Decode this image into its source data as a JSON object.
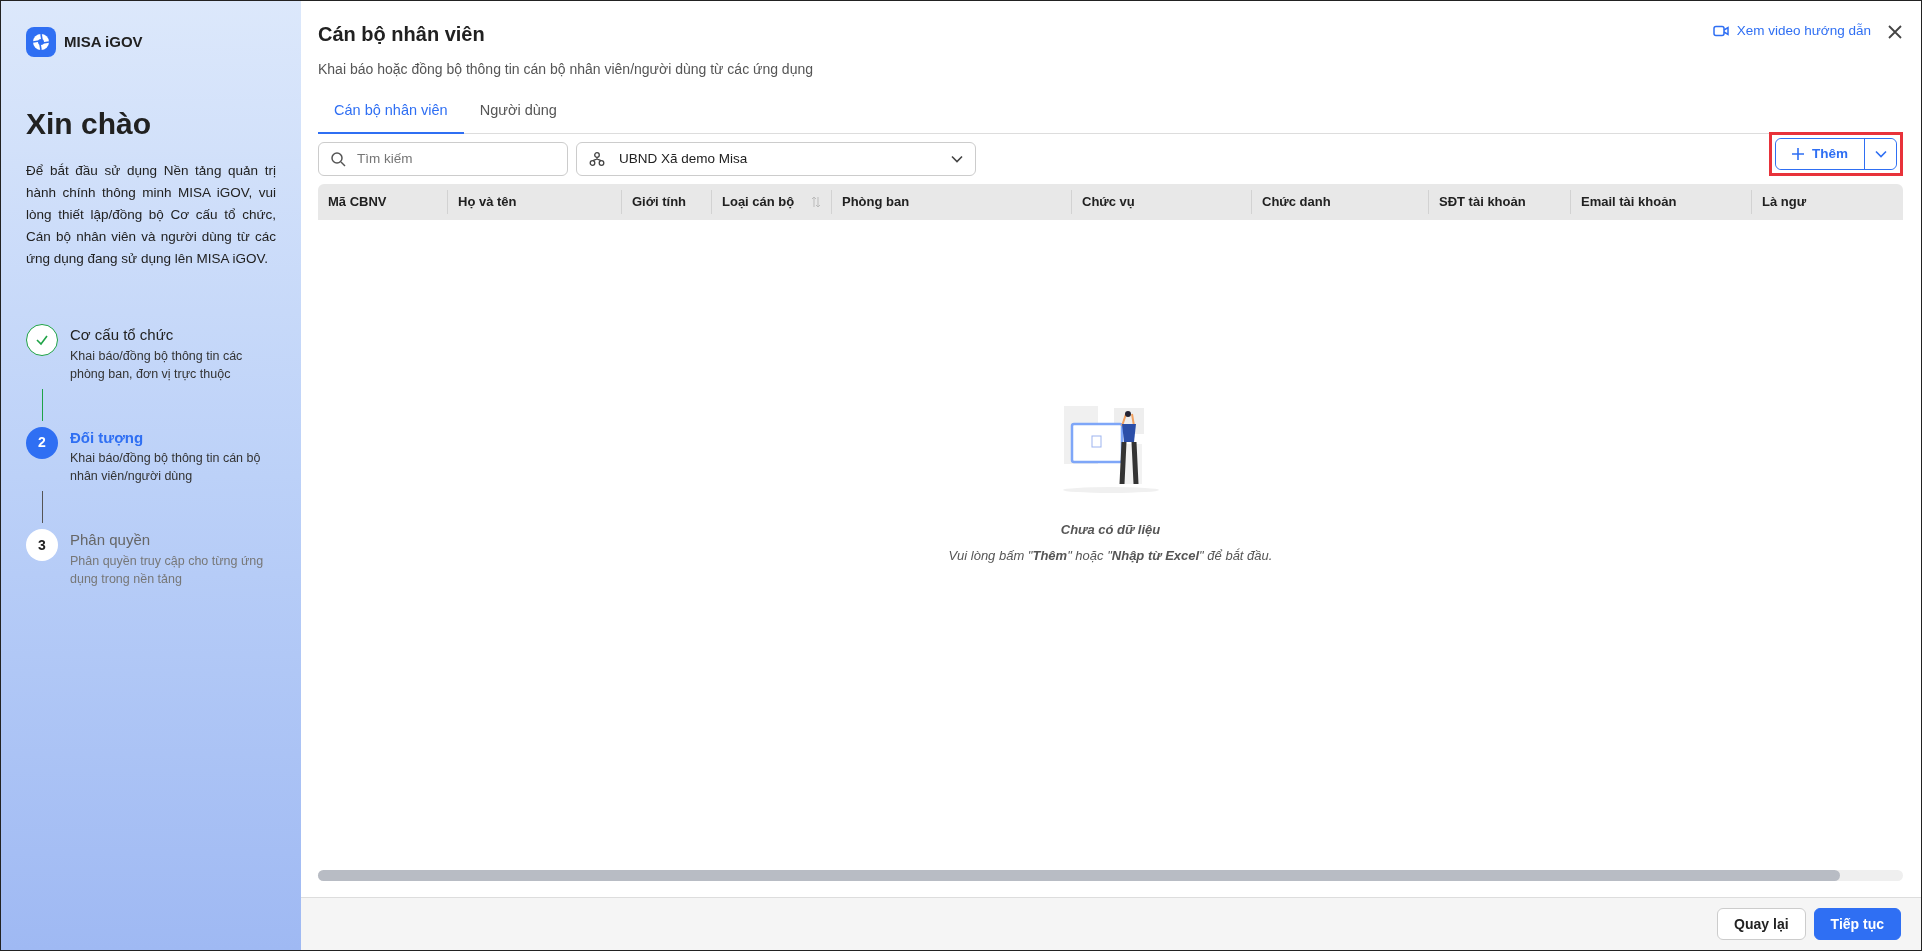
{
  "sidebar": {
    "brand": "MISA iGOV",
    "greeting": "Xin chào",
    "intro": "Để bắt đầu sử dụng Nền tảng quản trị hành chính thông minh MISA iGOV, vui lòng thiết lập/đồng bộ Cơ cấu tổ chức, Cán bộ nhân viên và người dùng từ các ứng dụng đang sử dụng lên MISA iGOV.",
    "steps": [
      {
        "title": "Cơ cấu tổ chức",
        "description": "Khai báo/đồng bộ thông tin các phòng ban, đơn vị trực thuộc",
        "completed": true,
        "selected": false
      },
      {
        "number": "2",
        "title": "Đối tượng",
        "description": "Khai báo/đồng bộ thông tin cán bộ nhân viên/người dùng",
        "completed": false,
        "selected": true
      },
      {
        "number": "3",
        "title": "Phân quyền",
        "description": "Phân quyền truy cập cho từng ứng dụng trong nền tảng",
        "completed": false,
        "selected": false
      }
    ]
  },
  "header": {
    "title": "Cán bộ nhân viên",
    "subtitle": "Khai báo hoặc đồng bộ thông tin cán bộ nhân viên/người dùng từ các ứng dụng",
    "video_link": "Xem video hướng dẫn"
  },
  "tabs": [
    {
      "label": "Cán bộ nhân viên",
      "selected": true
    },
    {
      "label": "Người dùng",
      "selected": false
    }
  ],
  "search": {
    "placeholder": "Tìm kiếm"
  },
  "unit_select": {
    "value": "UBND Xã demo Misa"
  },
  "add_button": {
    "label": "Thêm",
    "highlighted": true
  },
  "table": {
    "columns": [
      {
        "label": "Mã CBNV",
        "sortable": false
      },
      {
        "label": "Họ và tên",
        "sortable": false
      },
      {
        "label": "Giới tính",
        "sortable": false
      },
      {
        "label": "Loại cán bộ",
        "sortable": true
      },
      {
        "label": "Phòng ban",
        "sortable": false
      },
      {
        "label": "Chức vụ",
        "sortable": false
      },
      {
        "label": "Chức danh",
        "sortable": false
      },
      {
        "label": "SĐT tài khoản",
        "sortable": false
      },
      {
        "label": "Email tài khoản",
        "sortable": false
      },
      {
        "label": "Là ngư",
        "sortable": false
      }
    ]
  },
  "empty_state": {
    "title": "Chưa có dữ liệu",
    "hint": "Vui lòng bấm \"**Thêm**\" hoặc \"**Nhập từ Excel**\" để bắt đầu."
  },
  "footer": {
    "buttons": [
      {
        "label": "Quay lại",
        "kind": "secondary"
      },
      {
        "label": "Tiếp tục",
        "kind": "primary"
      }
    ]
  }
}
